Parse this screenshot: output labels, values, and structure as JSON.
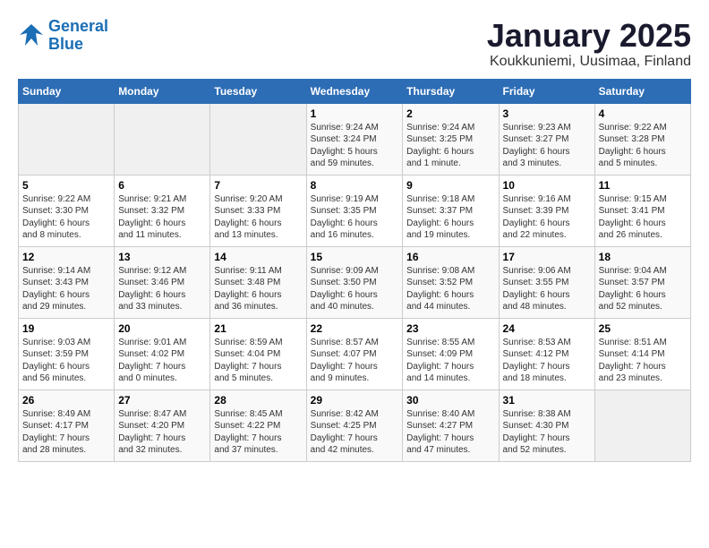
{
  "logo": {
    "line1": "General",
    "line2": "Blue"
  },
  "title": "January 2025",
  "subtitle": "Koukkuniemi, Uusimaa, Finland",
  "days_of_week": [
    "Sunday",
    "Monday",
    "Tuesday",
    "Wednesday",
    "Thursday",
    "Friday",
    "Saturday"
  ],
  "weeks": [
    [
      {
        "num": "",
        "info": "",
        "empty": true
      },
      {
        "num": "",
        "info": "",
        "empty": true
      },
      {
        "num": "",
        "info": "",
        "empty": true
      },
      {
        "num": "1",
        "info": "Sunrise: 9:24 AM\nSunset: 3:24 PM\nDaylight: 5 hours\nand 59 minutes."
      },
      {
        "num": "2",
        "info": "Sunrise: 9:24 AM\nSunset: 3:25 PM\nDaylight: 6 hours\nand 1 minute."
      },
      {
        "num": "3",
        "info": "Sunrise: 9:23 AM\nSunset: 3:27 PM\nDaylight: 6 hours\nand 3 minutes."
      },
      {
        "num": "4",
        "info": "Sunrise: 9:22 AM\nSunset: 3:28 PM\nDaylight: 6 hours\nand 5 minutes."
      }
    ],
    [
      {
        "num": "5",
        "info": "Sunrise: 9:22 AM\nSunset: 3:30 PM\nDaylight: 6 hours\nand 8 minutes."
      },
      {
        "num": "6",
        "info": "Sunrise: 9:21 AM\nSunset: 3:32 PM\nDaylight: 6 hours\nand 11 minutes."
      },
      {
        "num": "7",
        "info": "Sunrise: 9:20 AM\nSunset: 3:33 PM\nDaylight: 6 hours\nand 13 minutes."
      },
      {
        "num": "8",
        "info": "Sunrise: 9:19 AM\nSunset: 3:35 PM\nDaylight: 6 hours\nand 16 minutes."
      },
      {
        "num": "9",
        "info": "Sunrise: 9:18 AM\nSunset: 3:37 PM\nDaylight: 6 hours\nand 19 minutes."
      },
      {
        "num": "10",
        "info": "Sunrise: 9:16 AM\nSunset: 3:39 PM\nDaylight: 6 hours\nand 22 minutes."
      },
      {
        "num": "11",
        "info": "Sunrise: 9:15 AM\nSunset: 3:41 PM\nDaylight: 6 hours\nand 26 minutes."
      }
    ],
    [
      {
        "num": "12",
        "info": "Sunrise: 9:14 AM\nSunset: 3:43 PM\nDaylight: 6 hours\nand 29 minutes."
      },
      {
        "num": "13",
        "info": "Sunrise: 9:12 AM\nSunset: 3:46 PM\nDaylight: 6 hours\nand 33 minutes."
      },
      {
        "num": "14",
        "info": "Sunrise: 9:11 AM\nSunset: 3:48 PM\nDaylight: 6 hours\nand 36 minutes."
      },
      {
        "num": "15",
        "info": "Sunrise: 9:09 AM\nSunset: 3:50 PM\nDaylight: 6 hours\nand 40 minutes."
      },
      {
        "num": "16",
        "info": "Sunrise: 9:08 AM\nSunset: 3:52 PM\nDaylight: 6 hours\nand 44 minutes."
      },
      {
        "num": "17",
        "info": "Sunrise: 9:06 AM\nSunset: 3:55 PM\nDaylight: 6 hours\nand 48 minutes."
      },
      {
        "num": "18",
        "info": "Sunrise: 9:04 AM\nSunset: 3:57 PM\nDaylight: 6 hours\nand 52 minutes."
      }
    ],
    [
      {
        "num": "19",
        "info": "Sunrise: 9:03 AM\nSunset: 3:59 PM\nDaylight: 6 hours\nand 56 minutes."
      },
      {
        "num": "20",
        "info": "Sunrise: 9:01 AM\nSunset: 4:02 PM\nDaylight: 7 hours\nand 0 minutes."
      },
      {
        "num": "21",
        "info": "Sunrise: 8:59 AM\nSunset: 4:04 PM\nDaylight: 7 hours\nand 5 minutes."
      },
      {
        "num": "22",
        "info": "Sunrise: 8:57 AM\nSunset: 4:07 PM\nDaylight: 7 hours\nand 9 minutes."
      },
      {
        "num": "23",
        "info": "Sunrise: 8:55 AM\nSunset: 4:09 PM\nDaylight: 7 hours\nand 14 minutes."
      },
      {
        "num": "24",
        "info": "Sunrise: 8:53 AM\nSunset: 4:12 PM\nDaylight: 7 hours\nand 18 minutes."
      },
      {
        "num": "25",
        "info": "Sunrise: 8:51 AM\nSunset: 4:14 PM\nDaylight: 7 hours\nand 23 minutes."
      }
    ],
    [
      {
        "num": "26",
        "info": "Sunrise: 8:49 AM\nSunset: 4:17 PM\nDaylight: 7 hours\nand 28 minutes."
      },
      {
        "num": "27",
        "info": "Sunrise: 8:47 AM\nSunset: 4:20 PM\nDaylight: 7 hours\nand 32 minutes."
      },
      {
        "num": "28",
        "info": "Sunrise: 8:45 AM\nSunset: 4:22 PM\nDaylight: 7 hours\nand 37 minutes."
      },
      {
        "num": "29",
        "info": "Sunrise: 8:42 AM\nSunset: 4:25 PM\nDaylight: 7 hours\nand 42 minutes."
      },
      {
        "num": "30",
        "info": "Sunrise: 8:40 AM\nSunset: 4:27 PM\nDaylight: 7 hours\nand 47 minutes."
      },
      {
        "num": "31",
        "info": "Sunrise: 8:38 AM\nSunset: 4:30 PM\nDaylight: 7 hours\nand 52 minutes."
      },
      {
        "num": "",
        "info": "",
        "empty": true
      }
    ]
  ]
}
